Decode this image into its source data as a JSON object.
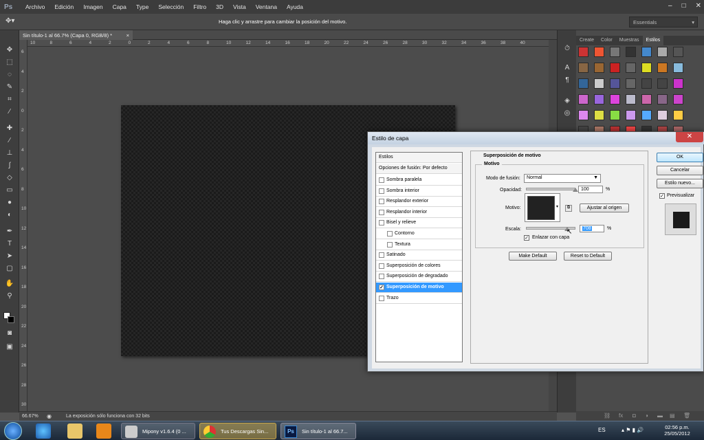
{
  "app": {
    "logo": "Ps"
  },
  "menu": [
    "Archivo",
    "Edición",
    "Imagen",
    "Capa",
    "Type",
    "Selección",
    "Filtro",
    "3D",
    "Vista",
    "Ventana",
    "Ayuda"
  ],
  "window_controls": {
    "minimize": "–",
    "maximize": "□",
    "close": "✕"
  },
  "options": {
    "tool_icon": "move-tool",
    "hint": "Haga clic y arrastre para cambiar la posición del motivo.",
    "workspace": "Essentials"
  },
  "document": {
    "tab_title": "Sin título-1 al 66.7% (Capa 0, RGB/8) *",
    "close": "×"
  },
  "ruler_h": [
    "10",
    "8",
    "6",
    "4",
    "2",
    "0",
    "2",
    "4",
    "6",
    "8",
    "10",
    "12",
    "14",
    "16",
    "18",
    "20",
    "22",
    "24",
    "26",
    "28",
    "30",
    "32",
    "34",
    "36",
    "38",
    "40"
  ],
  "ruler_v": [
    "6",
    "4",
    "2",
    "0",
    "2",
    "4",
    "6",
    "8",
    "10",
    "12",
    "14",
    "16",
    "18",
    "20",
    "22",
    "24",
    "26",
    "28",
    "30"
  ],
  "status": {
    "zoom": "66.67%",
    "info": "La exposición sólo funciona con 32 bits"
  },
  "panel": {
    "tabs": [
      "Create",
      "Color",
      "Muestras",
      "Estilos"
    ],
    "active_tab": "Estilos"
  },
  "dialog": {
    "title": "Estilo de capa",
    "close": "✕",
    "styles_header": "Estilos",
    "blend_options": "Opciones de fusión: Por defecto",
    "effects": [
      {
        "label": "Sombra paralela",
        "checked": false,
        "sub": false
      },
      {
        "label": "Sombra interior",
        "checked": false,
        "sub": false
      },
      {
        "label": "Resplandor exterior",
        "checked": false,
        "sub": false
      },
      {
        "label": "Resplandor interior",
        "checked": false,
        "sub": false
      },
      {
        "label": "Bisel y relieve",
        "checked": false,
        "sub": false
      },
      {
        "label": "Contorno",
        "checked": false,
        "sub": true
      },
      {
        "label": "Textura",
        "checked": false,
        "sub": true
      },
      {
        "label": "Satinado",
        "checked": false,
        "sub": false
      },
      {
        "label": "Superposición de colores",
        "checked": false,
        "sub": false
      },
      {
        "label": "Superposición de degradado",
        "checked": false,
        "sub": false
      },
      {
        "label": "Superposición de motivo",
        "checked": true,
        "sub": false,
        "selected": true
      },
      {
        "label": "Trazo",
        "checked": false,
        "sub": false
      }
    ],
    "section_title": "Superposición de motivo",
    "group_title": "Motivo",
    "blend_mode_label": "Modo de fusión:",
    "blend_mode_value": "Normal",
    "opacity_label": "Opacidad:",
    "opacity_value": "100",
    "opacity_level": 1.0,
    "percent": "%",
    "pattern_label": "Motivo:",
    "snap_button": "Ajustar al origen",
    "scale_label": "Escala:",
    "scale_value": "708",
    "link_label": "Enlazar con capa",
    "link_checked": true,
    "make_default": "Make Default",
    "reset_default": "Reset to Default",
    "ok": "OK",
    "cancel": "Cancelar",
    "new_style": "Estilo nuevo...",
    "preview_label": "Previsualizar",
    "preview_checked": true
  },
  "taskbar": {
    "items": [
      {
        "label": "",
        "icon": "windows-orb"
      },
      {
        "label": "",
        "icon": "ie-icon"
      },
      {
        "label": "",
        "icon": "folder-icon"
      },
      {
        "label": "",
        "icon": "media-player-icon"
      },
      {
        "label": "Mipony v1.6.4 (0 ...",
        "icon": "mipony-icon"
      },
      {
        "label": "Tus Descargas Sin...",
        "icon": "chrome-icon"
      },
      {
        "label": "Sin título-1 al 66.7...",
        "icon": "photoshop-icon"
      }
    ],
    "lang": "ES",
    "time": "02:56 p.m.",
    "date": "25/05/2012"
  }
}
